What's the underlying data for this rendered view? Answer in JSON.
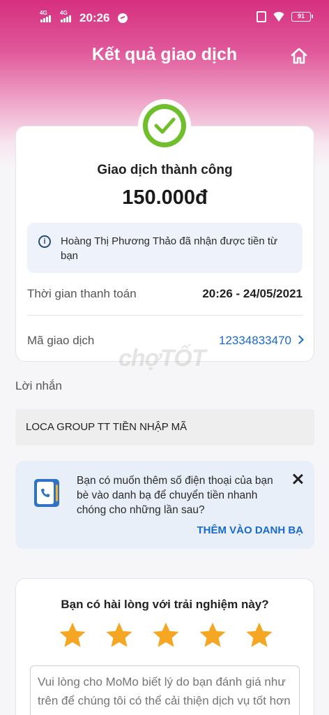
{
  "status_bar": {
    "network1": "4G",
    "network2": "4G",
    "time": "20:26",
    "battery": "91"
  },
  "header": {
    "title": "Kết quả giao dịch"
  },
  "result": {
    "status": "Giao dịch thành công",
    "amount": "150.000đ",
    "info": "Hoàng Thị Phương Thảo đã nhận được tiền từ bạn",
    "time_label": "Thời gian thanh toán",
    "time_value": "20:26 - 24/05/2021",
    "txn_label": "Mã giao dịch",
    "txn_value": "12334833470"
  },
  "watermark": "chợTỐT",
  "message": {
    "label": "Lời nhắn",
    "text": "LOCA GROUP TT TIỀN NHẬP MÃ"
  },
  "contact": {
    "text": "Bạn có muốn thêm số điện thoại của bạn bè vào danh bạ để chuyển tiền nhanh chóng cho những lần sau?",
    "action": "THÊM VÀO DANH BẠ"
  },
  "rating": {
    "question": "Bạn có hài lòng với trải nghiệm này?",
    "stars": 5,
    "max_stars": 5,
    "star_color": "#f5a623",
    "feedback_placeholder": "Vui lòng cho MoMo biết lý do bạn đánh giá như trên để chúng tôi có thể cải thiện dịch vụ tốt hơn"
  },
  "colors": {
    "brand": "#d62f7f",
    "success": "#6fbf2c",
    "link": "#1a6ac9"
  }
}
